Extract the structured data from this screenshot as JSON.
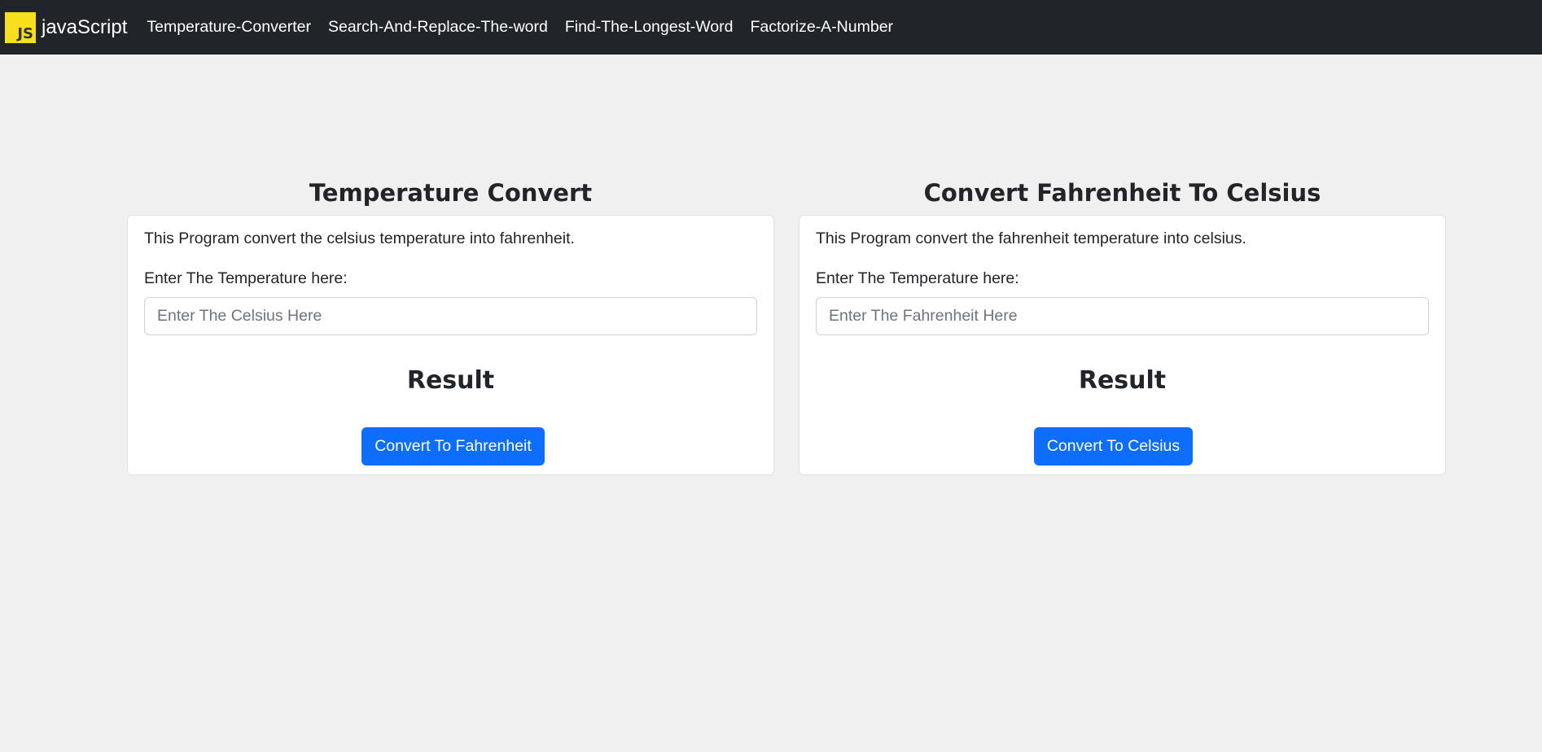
{
  "navbar": {
    "brand": {
      "logo_text": "JS",
      "title": "javaScript"
    },
    "links": [
      "Temperature-Converter",
      "Search-And-Replace-The-word",
      "Find-The-Longest-Word",
      "Factorize-A-Number"
    ]
  },
  "celsius_to_fahrenheit": {
    "title": "Temperature Convert",
    "description": "This Program convert the celsius temperature into fahrenheit.",
    "label": "Enter The Temperature here:",
    "input_placeholder": "Enter The Celsius Here",
    "input_value": "",
    "result": "Result",
    "button_label": "Convert To Fahrenheit"
  },
  "fahrenheit_to_celsius": {
    "title": "Convert Fahrenheit To Celsius",
    "description": "This Program convert the fahrenheit temperature into celsius.",
    "label": "Enter The Temperature here:",
    "input_placeholder": "Enter The Fahrenheit Here",
    "input_value": "",
    "result": "Result",
    "button_label": "Convert To Celsius"
  },
  "colors": {
    "navbar_bg": "#212529",
    "page_bg": "#f0f0f0",
    "js_logo_bg": "#f7df1e",
    "primary_button": "#0d6efd"
  }
}
